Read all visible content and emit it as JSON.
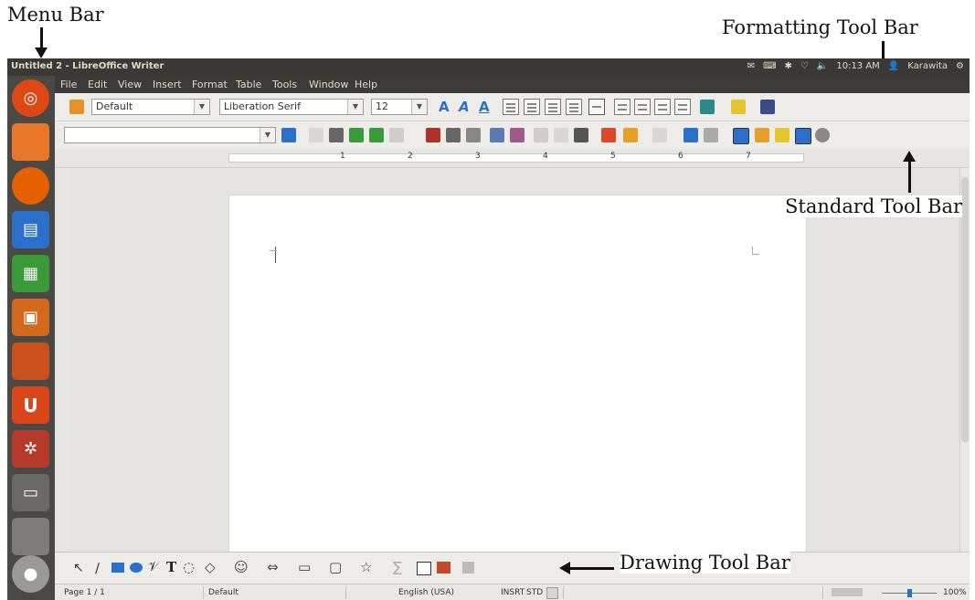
{
  "annotations": {
    "menu_bar": "Menu Bar",
    "formatting_tool_bar": "Formatting Tool Bar",
    "standard_tool_bar": "Standard Tool Bar",
    "drawing_tool_bar": "Drawing Tool Bar"
  },
  "window": {
    "title": "Untitled 2 - LibreOffice Writer",
    "tray": {
      "time": "10:13 AM",
      "user": "Karawita"
    }
  },
  "menu": {
    "items": [
      "File",
      "Edit",
      "View",
      "Insert",
      "Format",
      "Table",
      "Tools",
      "Window",
      "Help"
    ]
  },
  "formatting": {
    "paragraph_style": "Default",
    "font_name": "Liberation Serif",
    "font_size": "12"
  },
  "ruler": {
    "numbers": [
      "1",
      "2",
      "3",
      "4",
      "5",
      "6",
      "7"
    ]
  },
  "status": {
    "page": "Page 1 / 1",
    "page_style": "Default",
    "language": "English (USA)",
    "insert_mode": "INSRT",
    "selection_mode": "STD",
    "zoom": "100%"
  },
  "colors": {
    "launcher_ubuntu": "#dd4814",
    "launcher_files": "#f07a24",
    "accent_blue": "#2a6fc9"
  }
}
